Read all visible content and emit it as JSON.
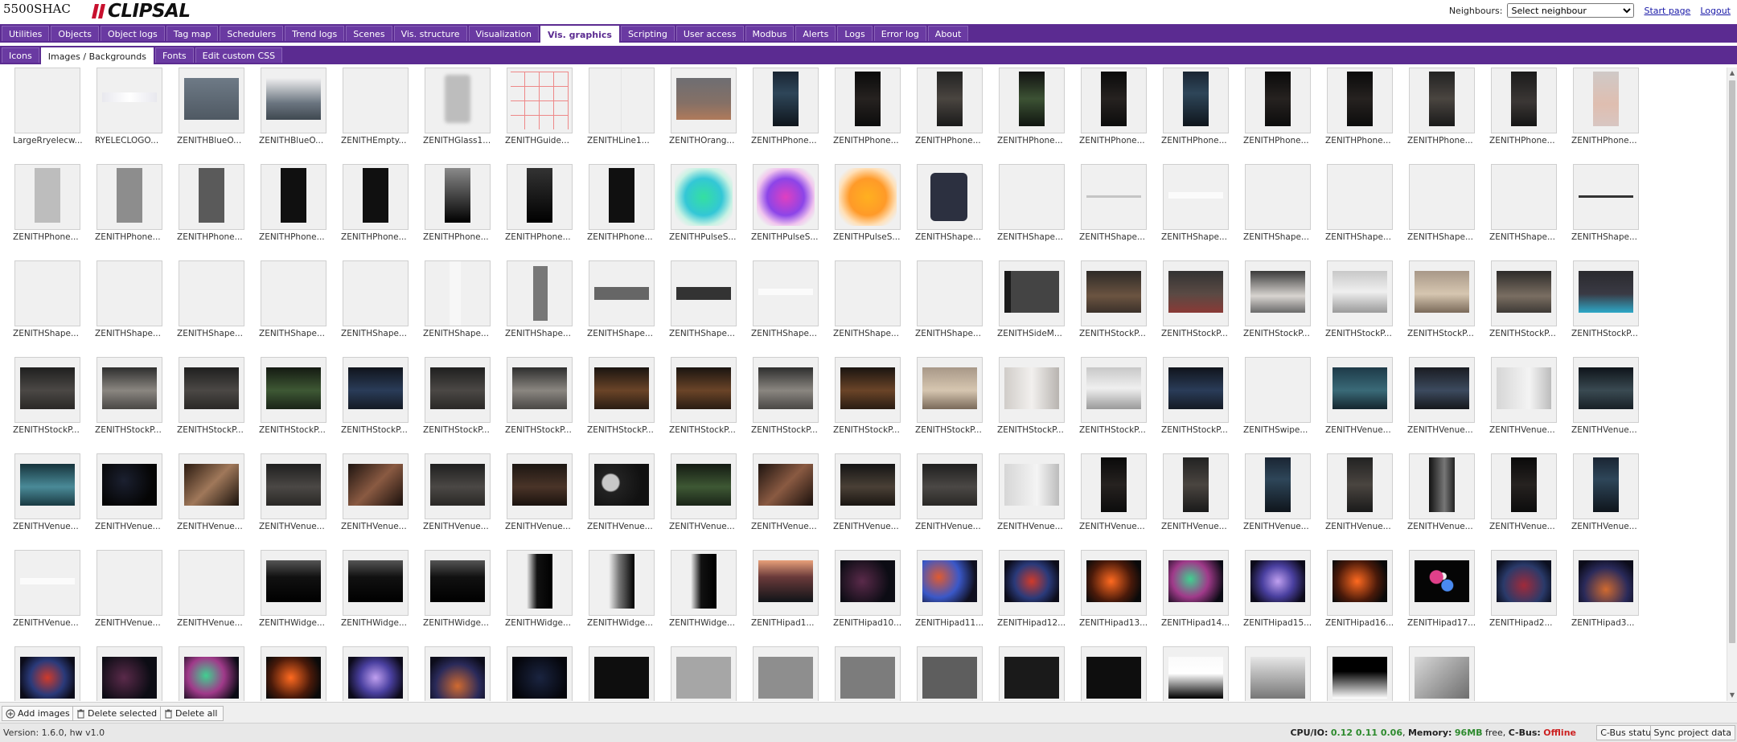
{
  "app": {
    "brand": "5500SHAC",
    "logo_text": "CLIPSAL",
    "neighbours_label": "Neighbours:",
    "neighbour_selected": "Select neighbour",
    "start_page": "Start page",
    "logout": "Logout"
  },
  "main_tabs": [
    "Utilities",
    "Objects",
    "Object logs",
    "Tag map",
    "Schedulers",
    "Trend logs",
    "Scenes",
    "Vis. structure",
    "Visualization",
    "Vis. graphics",
    "Scripting",
    "User access",
    "Modbus",
    "Alerts",
    "Logs",
    "Error log",
    "About"
  ],
  "main_active": "Vis. graphics",
  "sub_tabs": [
    "Icons",
    "Images / Backgrounds",
    "Fonts",
    "Edit custom CSS"
  ],
  "sub_active": "Images / Backgrounds",
  "images": [
    {
      "name": "LargeRryelecw...",
      "kind": "blank"
    },
    {
      "name": "RYELECLOGO...",
      "kind": "logo"
    },
    {
      "name": "ZENITHBlueO...",
      "kind": "slate"
    },
    {
      "name": "ZENITHBlueO...",
      "kind": "slate-fade"
    },
    {
      "name": "ZENITHEmpty...",
      "kind": "blank"
    },
    {
      "name": "ZENITHGlass1...",
      "kind": "glass"
    },
    {
      "name": "ZENITHGuide...",
      "kind": "guide"
    },
    {
      "name": "ZENITHLine1...",
      "kind": "line"
    },
    {
      "name": "ZENITHOrang...",
      "kind": "orange"
    },
    {
      "name": "ZENITHPhone...",
      "kind": "phone-blue"
    },
    {
      "name": "ZENITHPhone...",
      "kind": "phone-dark"
    },
    {
      "name": "ZENITHPhone...",
      "kind": "phone-room"
    },
    {
      "name": "ZENITHPhone...",
      "kind": "phone-green"
    },
    {
      "name": "ZENITHPhone...",
      "kind": "phone-dark"
    },
    {
      "name": "ZENITHPhone...",
      "kind": "phone-blue"
    },
    {
      "name": "ZENITHPhone...",
      "kind": "phone-dark"
    },
    {
      "name": "ZENITHPhone...",
      "kind": "phone-dark"
    },
    {
      "name": "ZENITHPhone...",
      "kind": "phone-room"
    },
    {
      "name": "ZENITHPhone...",
      "kind": "phone-vase"
    },
    {
      "name": "ZENITHPhone...",
      "kind": "phone-pink"
    },
    {
      "name": "ZENITHPhone...",
      "kind": "phone-lgrey"
    },
    {
      "name": "ZENITHPhone...",
      "kind": "phone-mgrey"
    },
    {
      "name": "ZENITHPhone...",
      "kind": "phone-dgrey"
    },
    {
      "name": "ZENITHPhone...",
      "kind": "phone-black"
    },
    {
      "name": "ZENITHPhone...",
      "kind": "phone-black"
    },
    {
      "name": "ZENITHPhone...",
      "kind": "phone-fade"
    },
    {
      "name": "ZENITHPhone...",
      "kind": "phone-fade2"
    },
    {
      "name": "ZENITHPhone...",
      "kind": "phone-black"
    },
    {
      "name": "ZENITHPulseS...",
      "kind": "pulse-green"
    },
    {
      "name": "ZENITHPulseS...",
      "kind": "pulse-pink"
    },
    {
      "name": "ZENITHPulseS...",
      "kind": "pulse-orange"
    },
    {
      "name": "ZENITHShape...",
      "kind": "shape-navy"
    },
    {
      "name": "ZENITHShape...",
      "kind": "blank"
    },
    {
      "name": "ZENITHShape...",
      "kind": "hline-grey"
    },
    {
      "name": "ZENITHShape...",
      "kind": "hline-white"
    },
    {
      "name": "ZENITHShape...",
      "kind": "blank"
    },
    {
      "name": "ZENITHShape...",
      "kind": "blank"
    },
    {
      "name": "ZENITHShape...",
      "kind": "blank"
    },
    {
      "name": "ZENITHShape...",
      "kind": "blank"
    },
    {
      "name": "ZENITHShape...",
      "kind": "hline-black"
    },
    {
      "name": "ZENITHShape...",
      "kind": "blank"
    },
    {
      "name": "ZENITHShape...",
      "kind": "blank"
    },
    {
      "name": "ZENITHShape...",
      "kind": "blank"
    },
    {
      "name": "ZENITHShape...",
      "kind": "blank"
    },
    {
      "name": "ZENITHShape...",
      "kind": "blank"
    },
    {
      "name": "ZENITHShape...",
      "kind": "vwhite"
    },
    {
      "name": "ZENITHShape...",
      "kind": "vbar-grey"
    },
    {
      "name": "ZENITHShape...",
      "kind": "hbar-grey"
    },
    {
      "name": "ZENITHShape...",
      "kind": "hbar-dark"
    },
    {
      "name": "ZENITHShape...",
      "kind": "hline-white"
    },
    {
      "name": "ZENITHShape...",
      "kind": "blank"
    },
    {
      "name": "ZENITHShape...",
      "kind": "blank"
    },
    {
      "name": "ZENITHSideM...",
      "kind": "side-menu"
    },
    {
      "name": "ZENITHStockP...",
      "kind": "stock-kitchen"
    },
    {
      "name": "ZENITHStockP...",
      "kind": "stock-red"
    },
    {
      "name": "ZENITHStockP...",
      "kind": "stock-bath"
    },
    {
      "name": "ZENITHStockP...",
      "kind": "stock-white"
    },
    {
      "name": "ZENITHStockP...",
      "kind": "stock-beige"
    },
    {
      "name": "ZENITHStockP...",
      "kind": "stock-bed"
    },
    {
      "name": "ZENITHStockP...",
      "kind": "stock-pool"
    },
    {
      "name": "ZENITHStockP...",
      "kind": "stock-dark"
    },
    {
      "name": "ZENITHStockP...",
      "kind": "stock-grey"
    },
    {
      "name": "ZENITHStockP...",
      "kind": "stock-dark"
    },
    {
      "name": "ZENITHStockP...",
      "kind": "stock-green"
    },
    {
      "name": "ZENITHStockP...",
      "kind": "stock-night"
    },
    {
      "name": "ZENITHStockP...",
      "kind": "stock-dark"
    },
    {
      "name": "ZENITHStockP...",
      "kind": "stock-grey"
    },
    {
      "name": "ZENITHStockP...",
      "kind": "stock-wood"
    },
    {
      "name": "ZENITHStockP...",
      "kind": "stock-wood"
    },
    {
      "name": "ZENITHStockP...",
      "kind": "stock-grey"
    },
    {
      "name": "ZENITHStockP...",
      "kind": "stock-wood"
    },
    {
      "name": "ZENITHStockP...",
      "kind": "stock-beige"
    },
    {
      "name": "ZENITHStockP...",
      "kind": "stock-vase"
    },
    {
      "name": "ZENITHStockP...",
      "kind": "stock-white"
    },
    {
      "name": "ZENITHStockP...",
      "kind": "stock-night"
    },
    {
      "name": "ZENITHSwipe...",
      "kind": "blank"
    },
    {
      "name": "ZENITHVenue...",
      "kind": "venue-blue"
    },
    {
      "name": "ZENITHVenue...",
      "kind": "venue-dark"
    },
    {
      "name": "ZENITHVenue...",
      "kind": "venue-white"
    },
    {
      "name": "ZENITHVenue...",
      "kind": "venue-night"
    },
    {
      "name": "ZENITHVenue...",
      "kind": "venue-teal"
    },
    {
      "name": "ZENITHVenue...",
      "kind": "venue-black"
    },
    {
      "name": "ZENITHVenue...",
      "kind": "venue-stairs"
    },
    {
      "name": "ZENITHVenue...",
      "kind": "stock-dark"
    },
    {
      "name": "ZENITHVenue...",
      "kind": "venue-warm"
    },
    {
      "name": "ZENITHVenue...",
      "kind": "stock-dark"
    },
    {
      "name": "ZENITHVenue...",
      "kind": "venue-brown"
    },
    {
      "name": "ZENITHVenue...",
      "kind": "venue-moon"
    },
    {
      "name": "ZENITHVenue...",
      "kind": "stock-green"
    },
    {
      "name": "ZENITHVenue...",
      "kind": "venue-warm"
    },
    {
      "name": "ZENITHVenue...",
      "kind": "venue-room"
    },
    {
      "name": "ZENITHVenue...",
      "kind": "stock-dark"
    },
    {
      "name": "ZENITHVenue...",
      "kind": "venue-white"
    },
    {
      "name": "ZENITHVenue...",
      "kind": "phone-dark"
    },
    {
      "name": "ZENITHVenue...",
      "kind": "phone-room"
    },
    {
      "name": "ZENITHVenue...",
      "kind": "phone-blue"
    },
    {
      "name": "ZENITHVenue...",
      "kind": "phone-room"
    },
    {
      "name": "ZENITHVenue...",
      "kind": "phone-fade3"
    },
    {
      "name": "ZENITHVenue...",
      "kind": "phone-dark"
    },
    {
      "name": "ZENITHVenue...",
      "kind": "phone-blue"
    },
    {
      "name": "ZENITHVenue...",
      "kind": "hline-white"
    },
    {
      "name": "ZENITHVenue...",
      "kind": "blank"
    },
    {
      "name": "ZENITHVenue...",
      "kind": "blank"
    },
    {
      "name": "ZENITHWidge...",
      "kind": "widget-fade"
    },
    {
      "name": "ZENITHWidge...",
      "kind": "widget-fade"
    },
    {
      "name": "ZENITHWidge...",
      "kind": "widget-fade"
    },
    {
      "name": "ZENITHWidge...",
      "kind": "widget-vfade"
    },
    {
      "name": "ZENITHWidge...",
      "kind": "widget-vfade2"
    },
    {
      "name": "ZENITHWidge...",
      "kind": "widget-vfade"
    },
    {
      "name": "ZENITHipad1...",
      "kind": "ipad-sunset"
    },
    {
      "name": "ZENITHipad10...",
      "kind": "ipad-blur1"
    },
    {
      "name": "ZENITHipad11...",
      "kind": "ipad-blur2"
    },
    {
      "name": "ZENITHipad12...",
      "kind": "ipad-blur3"
    },
    {
      "name": "ZENITHipad13...",
      "kind": "ipad-blur4"
    },
    {
      "name": "ZENITHipad14...",
      "kind": "ipad-blur5"
    },
    {
      "name": "ZENITHipad15...",
      "kind": "ipad-blur6"
    },
    {
      "name": "ZENITHipad16...",
      "kind": "ipad-blur4"
    },
    {
      "name": "ZENITHipad17...",
      "kind": "ipad-drops"
    },
    {
      "name": "ZENITHipad2...",
      "kind": "ipad-blur7"
    },
    {
      "name": "ZENITHipad3...",
      "kind": "ipad-blur8"
    },
    {
      "name": "",
      "kind": "ipad-blur3"
    },
    {
      "name": "",
      "kind": "ipad-blur1"
    },
    {
      "name": "",
      "kind": "ipad-blur5"
    },
    {
      "name": "",
      "kind": "ipad-blur4"
    },
    {
      "name": "",
      "kind": "ipad-blur6"
    },
    {
      "name": "",
      "kind": "ipad-blur8"
    },
    {
      "name": "",
      "kind": "ipad-navy"
    },
    {
      "name": "",
      "kind": "solid-black"
    },
    {
      "name": "",
      "kind": "solid-lgrey"
    },
    {
      "name": "",
      "kind": "solid-mgrey"
    },
    {
      "name": "",
      "kind": "solid-mgrey2"
    },
    {
      "name": "",
      "kind": "solid-dgrey"
    },
    {
      "name": "",
      "kind": "solid-black2"
    },
    {
      "name": "",
      "kind": "solid-black"
    },
    {
      "name": "",
      "kind": "grad-white"
    },
    {
      "name": "",
      "kind": "grad-grey"
    },
    {
      "name": "",
      "kind": "grad-black"
    },
    {
      "name": "",
      "kind": "grad-diag"
    }
  ],
  "footer": {
    "add_images": "Add images",
    "delete_selected": "Delete selected",
    "delete_all": "Delete all"
  },
  "status": {
    "version": "Version: 1.6.0, hw v1.0",
    "cpu_label": "CPU/IO:",
    "cpu_values": "0.12 0.11 0.06",
    "memory_label": "Memory:",
    "memory_value": "96MB",
    "memory_suffix": "free,",
    "cbus_label": "C-Bus:",
    "cbus_value": "Offline",
    "cbus_status_btn": "C-Bus status",
    "sync_btn": "Sync project data"
  },
  "colors": {
    "nav_purple": "#5b2b91",
    "ok_green": "#2d8a2d",
    "offline_red": "#cc2222"
  }
}
